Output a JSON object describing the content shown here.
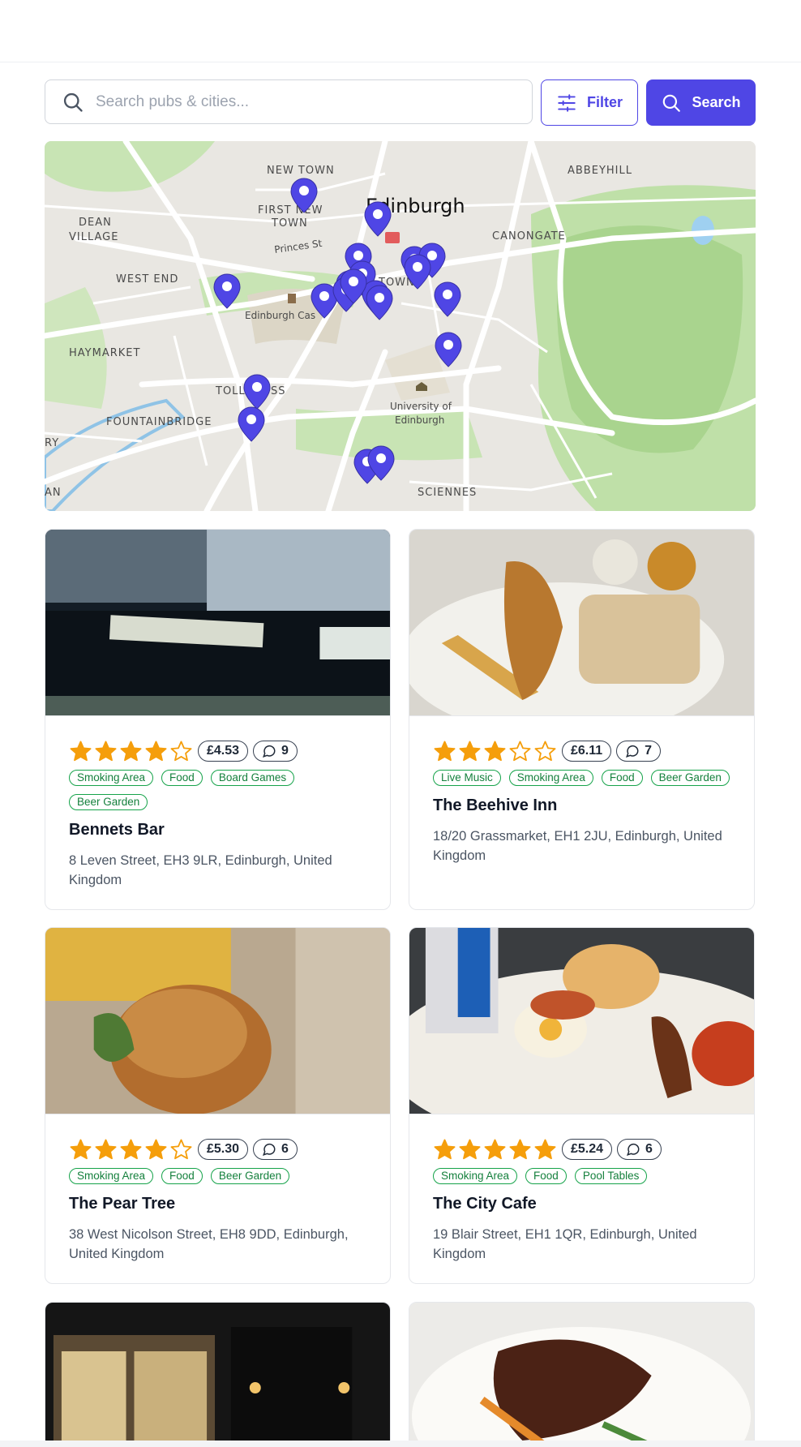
{
  "search": {
    "placeholder": "Search pubs & cities..."
  },
  "buttons": {
    "filter_label": "Filter",
    "search_label": "Search"
  },
  "map": {
    "city_label": "Edinburgh",
    "labels": [
      {
        "text": "NEW TOWN"
      },
      {
        "text": "FIRST NEW"
      },
      {
        "text": "TOWN"
      },
      {
        "text": "ABBEYHILL"
      },
      {
        "text": "DEAN"
      },
      {
        "text": "VILLAGE"
      },
      {
        "text": "CANONGATE"
      },
      {
        "text": "Princes St"
      },
      {
        "text": "WEST END"
      },
      {
        "text": "TOWN"
      },
      {
        "text": "Edinburgh Cas"
      },
      {
        "text": "HAYMARKET"
      },
      {
        "text": "TOLLCROSS"
      },
      {
        "text": "University of"
      },
      {
        "text": "Edinburgh"
      },
      {
        "text": "FOUNTAINBRIDGE"
      },
      {
        "text": "RY"
      },
      {
        "text": "SCIENNES"
      },
      {
        "text": "AN"
      }
    ],
    "pin_count": 20
  },
  "pubs": [
    {
      "name": "Bennets Bar",
      "rating": 4,
      "price": "£4.53",
      "reviews": "9",
      "tags": [
        "Smoking Area",
        "Food",
        "Board Games",
        "Beer Garden"
      ],
      "address": "8 Leven Street, EH3 9LR, Edinburgh, United Kingdom",
      "photo": "bar-sign-photo"
    },
    {
      "name": "The Beehive Inn",
      "rating": 3,
      "price": "£6.11",
      "reviews": "7",
      "tags": [
        "Live Music",
        "Smoking Area",
        "Food",
        "Beer Garden"
      ],
      "address": "18/20 Grassmarket, EH1 2JU, Edinburgh, United Kingdom",
      "photo": "fish-and-chips-photo"
    },
    {
      "name": "The Pear Tree",
      "rating": 4,
      "price": "£5.30",
      "reviews": "6",
      "tags": [
        "Smoking Area",
        "Food",
        "Beer Garden"
      ],
      "address": "38 West Nicolson Street, EH8 9DD, Edinburgh, United Kingdom",
      "photo": "burger-and-fries-photo"
    },
    {
      "name": "The City Cafe",
      "rating": 5,
      "price": "£5.24",
      "reviews": "6",
      "tags": [
        "Smoking Area",
        "Food",
        "Pool Tables"
      ],
      "address": "19 Blair Street, EH1 1QR, Edinburgh, United Kingdom",
      "photo": "breakfast-photo"
    },
    {
      "photo": "pub-exterior-night-photo"
    },
    {
      "photo": "steak-dish-photo"
    }
  ],
  "colors": {
    "accent": "#4f46e5",
    "star": "#f59e0b",
    "tag": "#16a34a"
  }
}
